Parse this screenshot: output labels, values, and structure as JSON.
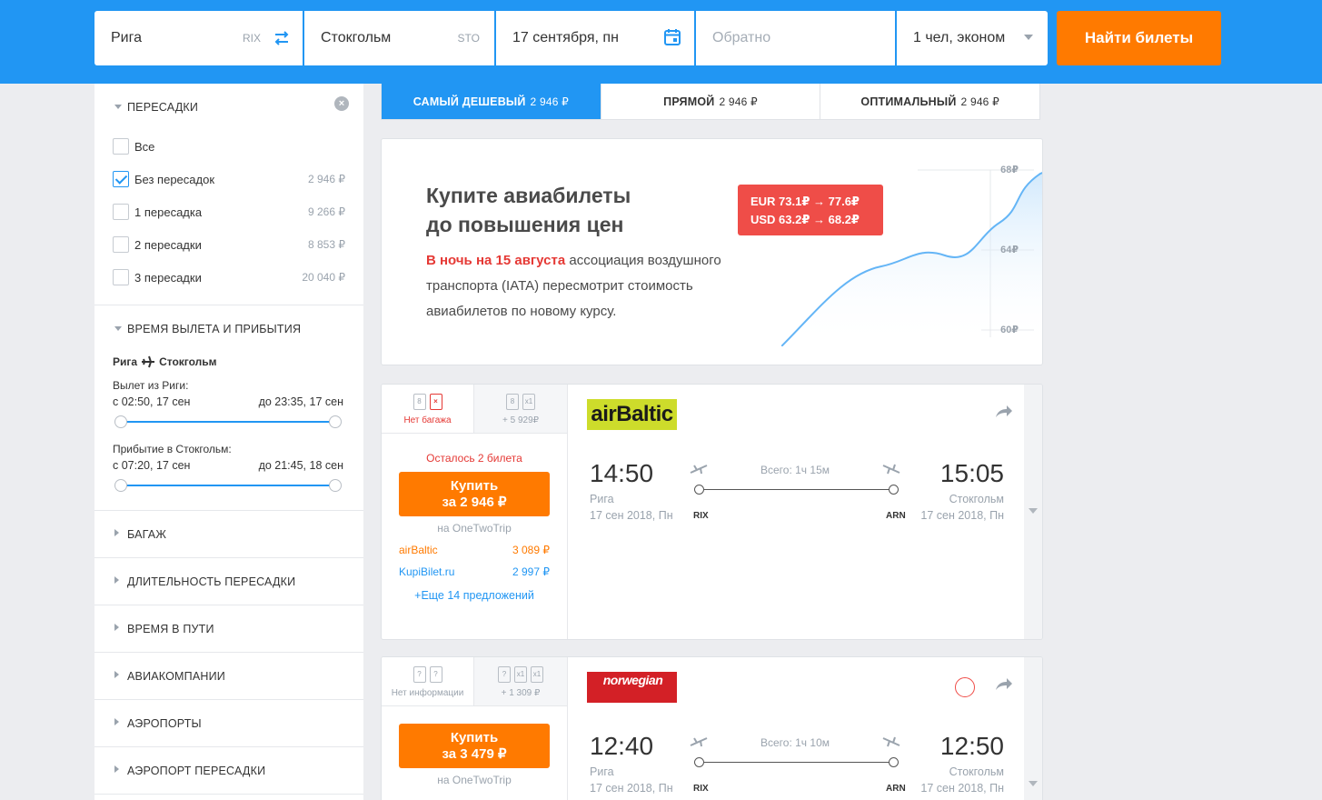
{
  "search": {
    "from_city": "Рига",
    "from_code": "RIX",
    "to_city": "Стокгольм",
    "to_code": "STO",
    "date": "17 сентября, пн",
    "return_placeholder": "Обратно",
    "passengers": "1 чел, эконом",
    "search_button": "Найти билеты"
  },
  "filters": {
    "stops_title": "ПЕРЕСАДКИ",
    "stops": [
      {
        "label": "Все",
        "price": "",
        "checked": false
      },
      {
        "label": "Без пересадок",
        "price": "2 946 ₽",
        "checked": true
      },
      {
        "label": "1 пересадка",
        "price": "9 266 ₽",
        "checked": false
      },
      {
        "label": "2 пересадки",
        "price": "8 853 ₽",
        "checked": false
      },
      {
        "label": "3 пересадки",
        "price": "20 040 ₽",
        "checked": false
      }
    ],
    "time_title": "ВРЕМЯ ВЫЛЕТА И ПРИБЫТИЯ",
    "route_from": "Рига",
    "route_to": "Стокгольм",
    "depart_label": "Вылет из Риги:",
    "depart_from": "с 02:50, 17 сен",
    "depart_to": "до 23:35, 17 сен",
    "arrive_label": "Прибытие в Стокгольм:",
    "arrive_from": "с 07:20, 17 сен",
    "arrive_to": "до 21:45, 18 сен",
    "collapsed": [
      "БАГАЖ",
      "ДЛИТЕЛЬНОСТЬ ПЕРЕСАДКИ",
      "ВРЕМЯ В ПУТИ",
      "АВИАКОМПАНИИ",
      "АЭРОПОРТЫ",
      "АЭРОПОРТ ПЕРЕСАДКИ"
    ]
  },
  "tabs": [
    {
      "label": "САМЫЙ ДЕШЕВЫЙ",
      "price": "2 946 ₽",
      "active": true
    },
    {
      "label": "ПРЯМОЙ",
      "price": "2 946 ₽",
      "active": false
    },
    {
      "label": "ОПТИМАЛЬНЫЙ",
      "price": "2 946 ₽",
      "active": false
    }
  ],
  "banner": {
    "title_line1": "Купите авиабилеты",
    "title_line2": "до повышения цен",
    "text_red": "В ночь на 15 августа",
    "text_rest": " ассоциация воздушного транспорта (IATA) пересмотрит стоимость авиабилетов по новому курсу.",
    "rate_eur": "EUR 73.1₽ → 77.6₽",
    "rate_usd": "USD 63.2₽ → 68.2₽",
    "y_labels": [
      "68₽",
      "64₽",
      "60₽"
    ]
  },
  "tickets": [
    {
      "bag1_label": "Нет багажа",
      "bag2_label": "+ 5 929₽",
      "remaining": "Осталось 2 билета",
      "buy_line1": "Купить",
      "buy_line2": "за 2 946 ₽",
      "via": "на OneTwoTrip",
      "alt1_name": "airBaltic",
      "alt1_price": "3 089 ₽",
      "alt2_name": "KupiBilet.ru",
      "alt2_price": "2 997 ₽",
      "more": "+Еще 14 предложений",
      "airline": "airBaltic",
      "dep_time": "14:50",
      "dep_city": "Рига",
      "dep_date": "17 сен 2018, Пн",
      "dep_code": "RIX",
      "duration": "Всего: 1ч 15м",
      "arr_time": "15:05",
      "arr_city": "Стокгольм",
      "arr_date": "17 сен 2018, Пн",
      "arr_code": "ARN"
    },
    {
      "bag1_label": "Нет информации",
      "bag2_label": "+ 1 309 ₽",
      "buy_line1": "Купить",
      "buy_line2": "за 3 479 ₽",
      "via": "на OneTwoTrip",
      "airline": "norwegian",
      "dep_time": "12:40",
      "dep_city": "Рига",
      "dep_date": "17 сен 2018, Пн",
      "dep_code": "RIX",
      "duration": "Всего: 1ч 10м",
      "arr_time": "12:50",
      "arr_city": "Стокгольм",
      "arr_date": "17 сен 2018, Пн",
      "arr_code": "ARN"
    }
  ]
}
